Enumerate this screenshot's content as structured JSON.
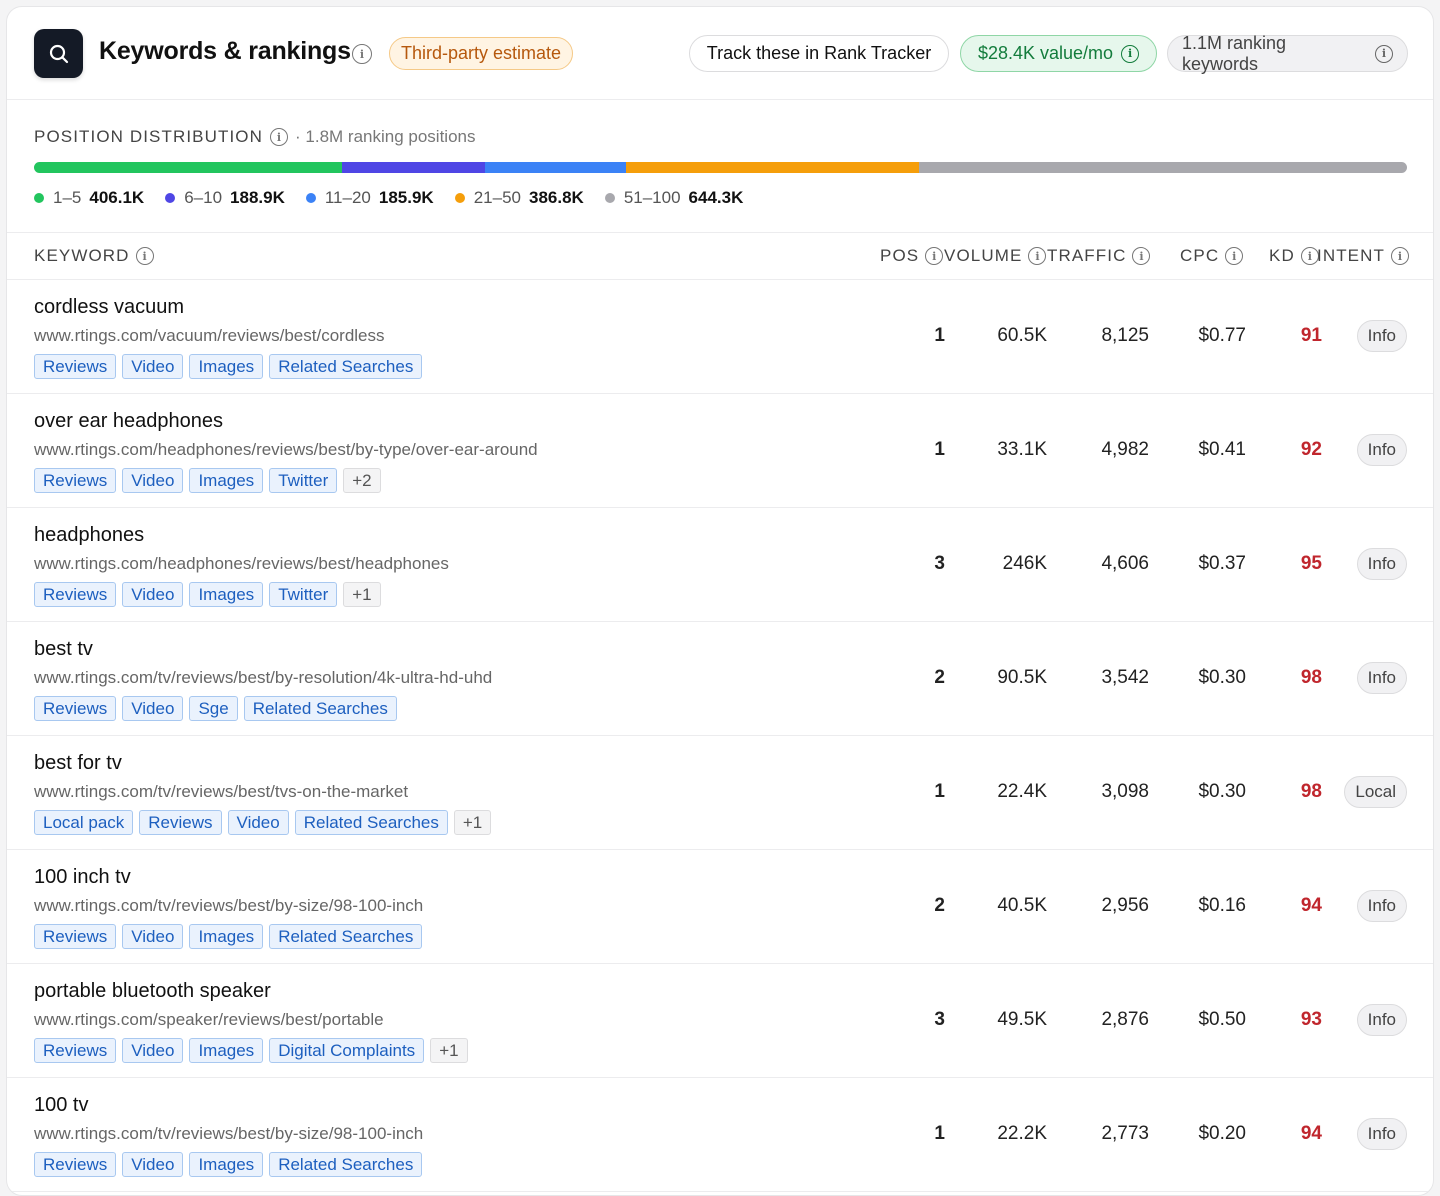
{
  "header": {
    "title": "Keywords & rankings",
    "estimate_badge": "Third-party estimate",
    "track_button": "Track these in Rank Tracker",
    "value_pill": "$28.4K value/mo",
    "ranking_pill": "1.1M ranking keywords"
  },
  "distribution": {
    "title": "POSITION DISTRIBUTION",
    "subtitle": "· 1.8M ranking positions",
    "segments": [
      {
        "range": "1–5",
        "count": "406.1K",
        "value": 406.1,
        "color": "#22c55e"
      },
      {
        "range": "6–10",
        "count": "188.9K",
        "value": 188.9,
        "color": "#4f46e5"
      },
      {
        "range": "11–20",
        "count": "185.9K",
        "value": 185.9,
        "color": "#3b82f6"
      },
      {
        "range": "21–50",
        "count": "386.8K",
        "value": 386.8,
        "color": "#f59e0b"
      },
      {
        "range": "51–100",
        "count": "644.3K",
        "value": 644.3,
        "color": "#a8a8ad"
      }
    ]
  },
  "table": {
    "columns": {
      "keyword": "KEYWORD",
      "pos": "POS",
      "volume": "VOLUME",
      "traffic": "TRAFFIC",
      "cpc": "CPC",
      "kd": "KD",
      "intent": "INTENT"
    },
    "rows": [
      {
        "keyword": "cordless vacuum",
        "url": "www.rtings.com/vacuum/reviews/best/cordless",
        "tags": [
          "Reviews",
          "Video",
          "Images",
          "Related Searches"
        ],
        "more": "",
        "pos": "1",
        "volume": "60.5K",
        "traffic": "8,125",
        "cpc": "$0.77",
        "kd": "91",
        "intent": "Info"
      },
      {
        "keyword": "over ear headphones",
        "url": "www.rtings.com/headphones/reviews/best/by-type/over-ear-around",
        "tags": [
          "Reviews",
          "Video",
          "Images",
          "Twitter"
        ],
        "more": "+2",
        "pos": "1",
        "volume": "33.1K",
        "traffic": "4,982",
        "cpc": "$0.41",
        "kd": "92",
        "intent": "Info"
      },
      {
        "keyword": "headphones",
        "url": "www.rtings.com/headphones/reviews/best/headphones",
        "tags": [
          "Reviews",
          "Video",
          "Images",
          "Twitter"
        ],
        "more": "+1",
        "pos": "3",
        "volume": "246K",
        "traffic": "4,606",
        "cpc": "$0.37",
        "kd": "95",
        "intent": "Info"
      },
      {
        "keyword": "best tv",
        "url": "www.rtings.com/tv/reviews/best/by-resolution/4k-ultra-hd-uhd",
        "tags": [
          "Reviews",
          "Video",
          "Sge",
          "Related Searches"
        ],
        "more": "",
        "pos": "2",
        "volume": "90.5K",
        "traffic": "3,542",
        "cpc": "$0.30",
        "kd": "98",
        "intent": "Info"
      },
      {
        "keyword": "best for tv",
        "url": "www.rtings.com/tv/reviews/best/tvs-on-the-market",
        "tags": [
          "Local pack",
          "Reviews",
          "Video",
          "Related Searches"
        ],
        "more": "+1",
        "pos": "1",
        "volume": "22.4K",
        "traffic": "3,098",
        "cpc": "$0.30",
        "kd": "98",
        "intent": "Local"
      },
      {
        "keyword": "100 inch tv",
        "url": "www.rtings.com/tv/reviews/best/by-size/98-100-inch",
        "tags": [
          "Reviews",
          "Video",
          "Images",
          "Related Searches"
        ],
        "more": "",
        "pos": "2",
        "volume": "40.5K",
        "traffic": "2,956",
        "cpc": "$0.16",
        "kd": "94",
        "intent": "Info"
      },
      {
        "keyword": "portable bluetooth speaker",
        "url": "www.rtings.com/speaker/reviews/best/portable",
        "tags": [
          "Reviews",
          "Video",
          "Images",
          "Digital Complaints"
        ],
        "more": "+1",
        "pos": "3",
        "volume": "49.5K",
        "traffic": "2,876",
        "cpc": "$0.50",
        "kd": "93",
        "intent": "Info"
      },
      {
        "keyword": "100 tv",
        "url": "www.rtings.com/tv/reviews/best/by-size/98-100-inch",
        "tags": [
          "Reviews",
          "Video",
          "Images",
          "Related Searches"
        ],
        "more": "",
        "pos": "1",
        "volume": "22.2K",
        "traffic": "2,773",
        "cpc": "$0.20",
        "kd": "94",
        "intent": "Info"
      }
    ]
  },
  "icons": {
    "logo": "search-icon",
    "info": "info-icon"
  }
}
